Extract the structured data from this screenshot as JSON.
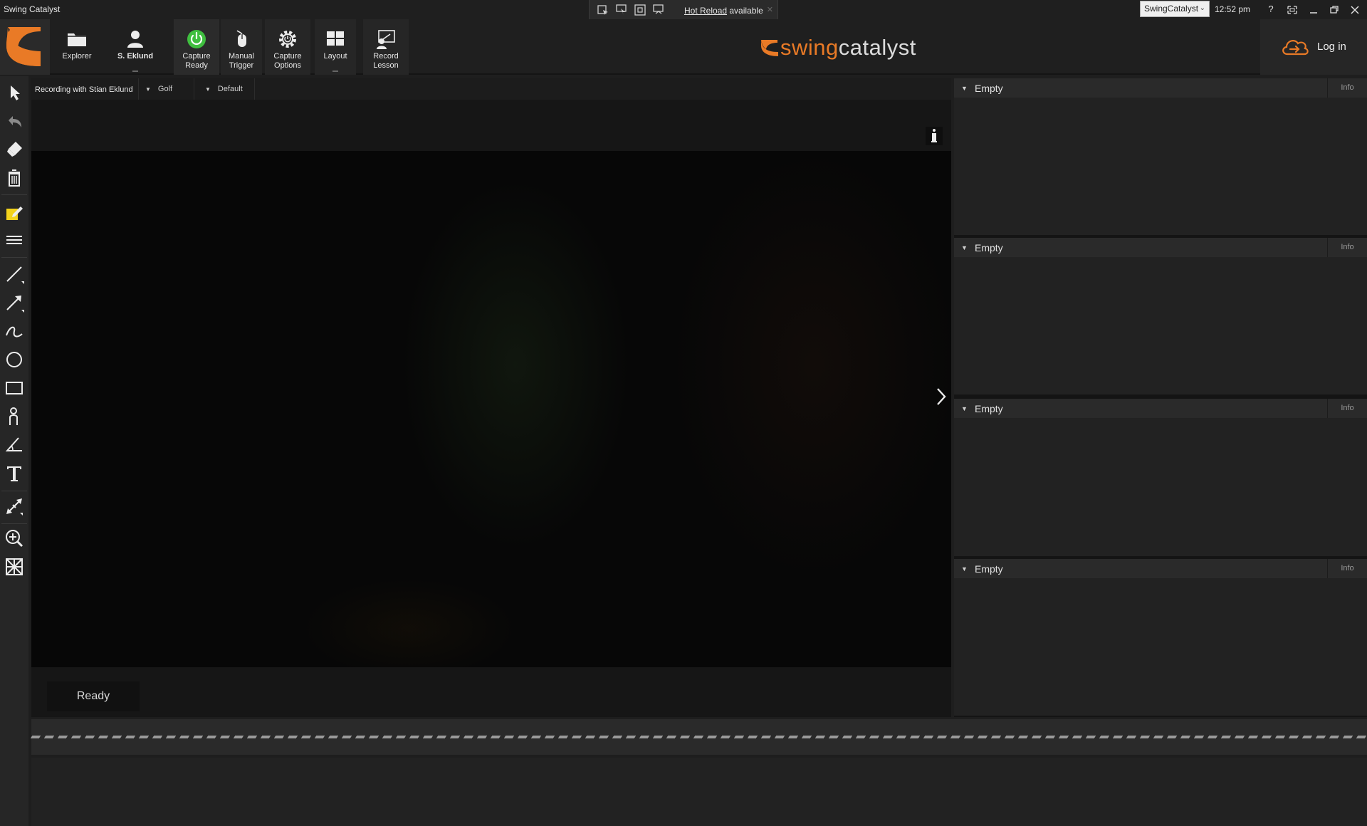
{
  "window": {
    "title": "Swing Catalyst",
    "hot_reload_text": "Hot Reload",
    "hot_reload_suffix": " available",
    "profile_select": "SwingCatalyst",
    "time": "12:52 pm",
    "help_label": "?"
  },
  "ribbon": {
    "explorer": "Explorer",
    "user": "S. Eklund",
    "capture_ready_1": "Capture",
    "capture_ready_2": "Ready",
    "manual_trigger_1": "Manual",
    "manual_trigger_2": "Trigger",
    "capture_options_1": "Capture",
    "capture_options_2": "Options",
    "layout": "Layout",
    "record_lesson_1": "Record",
    "record_lesson_2": "Lesson",
    "brand_swing": "swing",
    "brand_catalyst": "catalyst",
    "login": "Log in"
  },
  "video": {
    "title": "Recording with Stian Eklund",
    "sport": "Golf",
    "preset": "Default",
    "status": "Ready"
  },
  "panels": [
    {
      "title": "Empty",
      "info": "Info"
    },
    {
      "title": "Empty",
      "info": "Info"
    },
    {
      "title": "Empty",
      "info": "Info"
    },
    {
      "title": "Empty",
      "info": "Info"
    }
  ],
  "colors": {
    "accent_orange": "#e97a26",
    "capture_green": "#3fbf3f",
    "note_yellow": "#f2d21c"
  },
  "icons": [
    "select-arrow-icon",
    "undo-icon",
    "eraser-icon",
    "trash-icon",
    "note-icon",
    "lines-icon",
    "line-icon",
    "arrow-line-icon",
    "freehand-icon",
    "circle-icon",
    "rectangle-icon",
    "body-icon",
    "angle-icon",
    "text-icon",
    "measure-icon",
    "zoom-icon",
    "grid-icon"
  ]
}
